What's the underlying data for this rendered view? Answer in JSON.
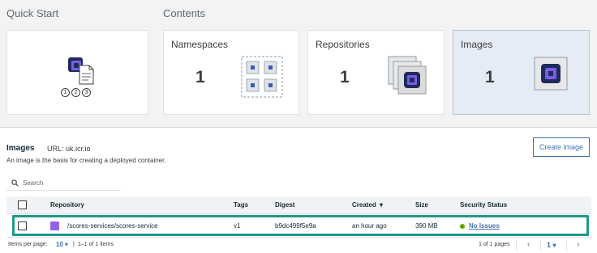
{
  "sections": {
    "quick_start_label": "Quick Start",
    "contents_label": "Contents"
  },
  "quick_start": {
    "steps": [
      "1",
      "2",
      "3"
    ]
  },
  "cards": {
    "namespaces": {
      "title": "Namespaces",
      "count": "1"
    },
    "repositories": {
      "title": "Repositories",
      "count": "1"
    },
    "images": {
      "title": "Images",
      "count": "1"
    }
  },
  "images_panel": {
    "title": "Images",
    "url": "URL: uk.icr.io",
    "description": "An image is the basis for creating a deployed container.",
    "create_button": "Create image",
    "search_placeholder": "Search"
  },
  "table": {
    "headers": {
      "repository": "Repository",
      "tags": "Tags",
      "digest": "Digest",
      "created": "Created",
      "created_sort": "▾",
      "size": "Size",
      "security_status": "Security Status"
    },
    "rows": [
      {
        "repository": "/scores-services/scores-service",
        "repository_color": "#9265e6",
        "tags": "v1",
        "digest": "b9dc499f5e9a",
        "created": "an hour ago",
        "size": "390 MB",
        "security_status": "No Issues",
        "status_color": "#5aa700"
      }
    ]
  },
  "footer": {
    "items_per_page_label": "Items per page:",
    "items_per_page_value": "10",
    "items_range": "1–1 of 1 items",
    "pages_label": "1 of 1 pages",
    "current_page": "1"
  },
  "colors": {
    "accent": "#3d70b2",
    "highlight": "#1d9a88"
  }
}
